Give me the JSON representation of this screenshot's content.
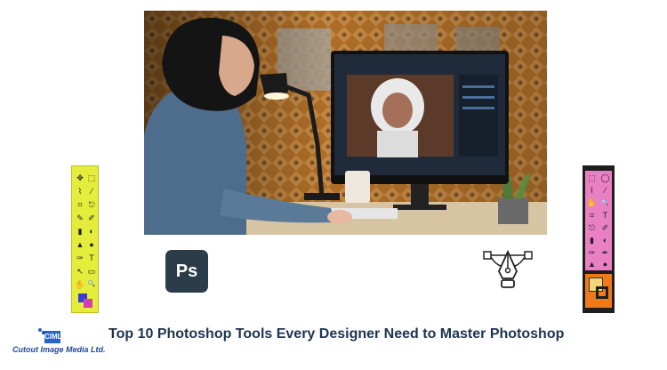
{
  "headline": "Top 10 Photoshop Tools Every Designer Need to Master Photoshop",
  "ps_logo": {
    "label": "Ps"
  },
  "company_logo": {
    "badge": "CIML",
    "name": "Cutout Image Media Ltd."
  },
  "icons": {
    "pen_tool": "pen-tool-icon",
    "left_toolbar": "photoshop-toolbar-icon",
    "right_toolbar": "photoshop-toolbar-icon"
  },
  "colors": {
    "headline": "#1d3450",
    "left_toolbar_bg": "#e4ec3c",
    "right_toolbar_bg": "#ea80c4",
    "ps_logo_bg": "#2b3d4b",
    "brand_blue": "#2a62c9"
  },
  "toolbar_glyphs": {
    "left": [
      "✥",
      "⬚",
      "⌇",
      "⁄",
      "⌗",
      "⎋",
      "✎",
      "✐",
      "▮",
      "◐",
      "▲",
      "●",
      "✑",
      "T",
      "↖",
      "▭",
      "✋",
      "🔍"
    ],
    "right": [
      "⬚",
      "◯",
      "⌇",
      "⁄",
      "✋",
      "🔍",
      "⌗",
      "T",
      "⎋",
      "✐",
      "▮",
      "◐",
      "✑",
      "✒",
      "▲",
      "●"
    ]
  }
}
